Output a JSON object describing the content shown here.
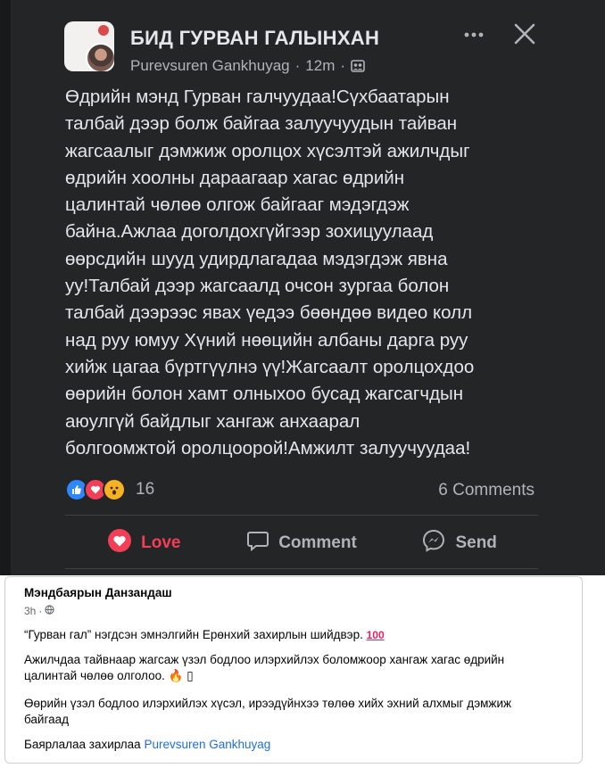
{
  "post": {
    "group_name": "БИД ГУРВАН ГАЛЫНХАН",
    "author": "Purevsuren Gankhuyag",
    "separator": "·",
    "time": "12m",
    "text_lines": [
      "Өдрийн мэнд Гурван галчуудаа!Сүхбаатарын",
      "талбай дээр болж байгаа залуучуудын тайван",
      "жагсаалыг дэмжиж оролцох хүсэлтэй ажилчдыг",
      "өдрийн хоолны дараагаар хагас өдрийн",
      "цалинтай чөлөө олгож байгааг мэдэгдэж",
      "байна.Ажлаа доголдохгүйгээр зохицуулаад",
      "өөрсдийн шууд удирдлагадаа мэдэгдэж явна",
      "уу!Талбай дээр жагсаалд очсон зургаа болон",
      "талбай дээрээс явах үедээ бөөндөө видео колл",
      "над руу юмуу Хүний нөөцийн албаны дарга руу",
      "хийж цагаа бүртгүүлнэ үү!Жагсаалт оролцохдоо",
      "өөрийн болон хамт олныхоо бусад жагсагчдын",
      "аюулгүй байдлыг  хангаж анхаарал",
      "болгоомжтой оролцоорой!Амжилт залуучуудаа!"
    ],
    "reaction_count": "16",
    "comments_count": "6 Comments",
    "actions": {
      "love": "Love",
      "comment": "Comment",
      "send": "Send"
    },
    "colors": {
      "background": "#242526",
      "text": "#e4e6eb",
      "muted": "#b0b3b8",
      "love": "#f33e58",
      "like": "#2d88ff",
      "wow": "#f7b125"
    }
  },
  "comment_card": {
    "name": "Мэндбаярын Данзандаш",
    "time": "3h",
    "separator": "·",
    "paragraph1": "“Гурван гал” нэгдсэн эмнэлгийн Ерөнхий захирлын шийдвэр.",
    "paragraph1_emoji": "100",
    "paragraph2_line1": "Ажилчдаа тайвнаар жагсаж үзэл бодлоо илэрхийлэх боломжоор хангаж хагас өдрийн",
    "paragraph2_line2": "цалинтай чөлөө олголоо.",
    "paragraph2_emoji": "🔥",
    "paragraph2_box": "▯",
    "paragraph3_line1": "Өөрийн үзэл бодлоо илэрхийлэх хүсэл, ирээдүйнхээ төлөө хийх эхний алхмыг дэмжиж",
    "paragraph3_line2": "байгаад",
    "paragraph4_prefix": "Баярлалаа захирлаа ",
    "paragraph4_mention": "Purevsuren Gankhuyag",
    "colors": {
      "link": "#216fdb",
      "text": "#050505",
      "muted": "#65676b"
    }
  }
}
